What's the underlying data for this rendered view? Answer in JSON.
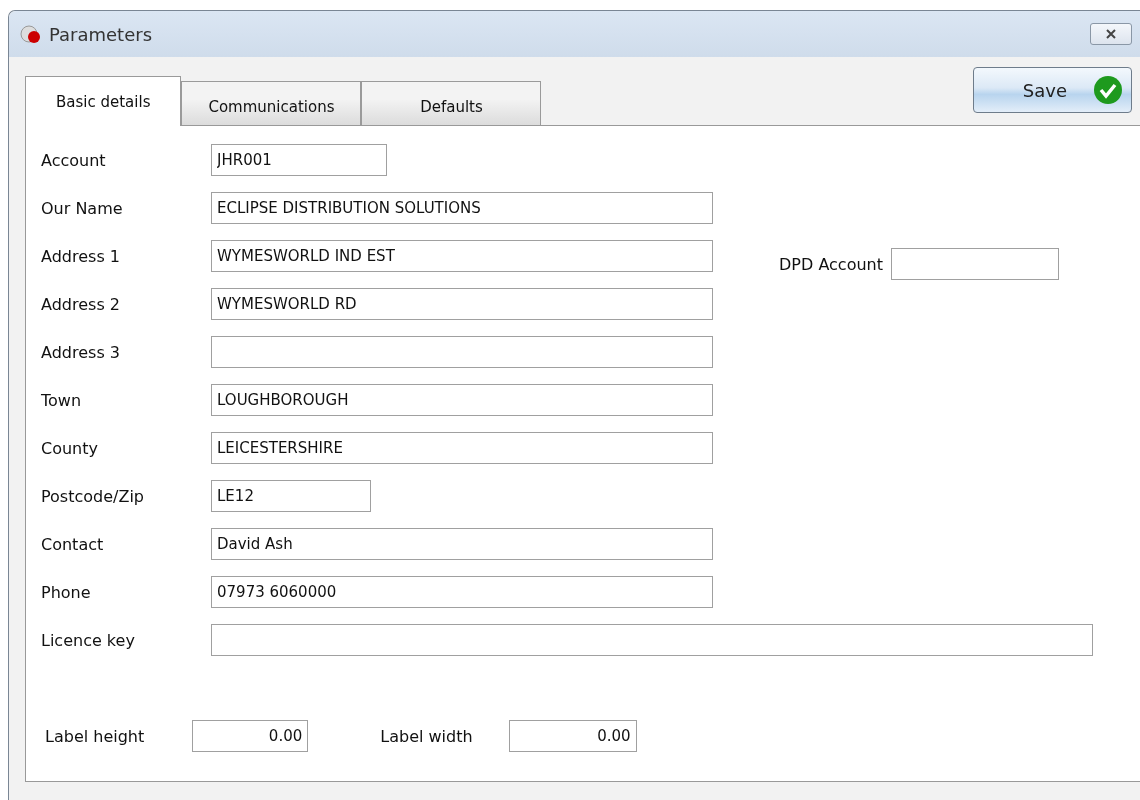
{
  "window": {
    "title": "Parameters"
  },
  "tabs": [
    {
      "label": "Basic details",
      "selected": true
    },
    {
      "label": "Communications",
      "selected": false
    },
    {
      "label": "Defaults",
      "selected": false
    }
  ],
  "save_button": {
    "label": "Save"
  },
  "fields": [
    {
      "label": "Account",
      "value": "JHR001",
      "kind": "code"
    },
    {
      "label": "Our Name",
      "value": "ECLIPSE DISTRIBUTION SOLUTIONS",
      "kind": "text"
    },
    {
      "label": "Address 1",
      "value": "WYMESWORLD IND EST",
      "kind": "text"
    },
    {
      "label": "Address 2",
      "value": "WYMESWORLD RD",
      "kind": "text"
    },
    {
      "label": "Address 3",
      "kind": "text"
    },
    {
      "label": "Town",
      "value": "LOUGHBOROUGH",
      "kind": "text"
    },
    {
      "label": "County",
      "value": "LEICESTERSHIRE",
      "kind": "text"
    },
    {
      "label": "Postcode/Zip",
      "value": "LE12",
      "kind": "postcode"
    },
    {
      "label": "Contact",
      "value": "David Ash",
      "kind": "text"
    },
    {
      "label": "Phone",
      "value": "07973 6060000",
      "kind": "text"
    },
    {
      "label": "Licence key",
      "kind": "key"
    }
  ],
  "dpd_account": {
    "label": "DPD Account"
  },
  "label_height": {
    "label": "Label height",
    "value": "0.00"
  },
  "label_width": {
    "label": "Label width",
    "value": "0.00"
  }
}
